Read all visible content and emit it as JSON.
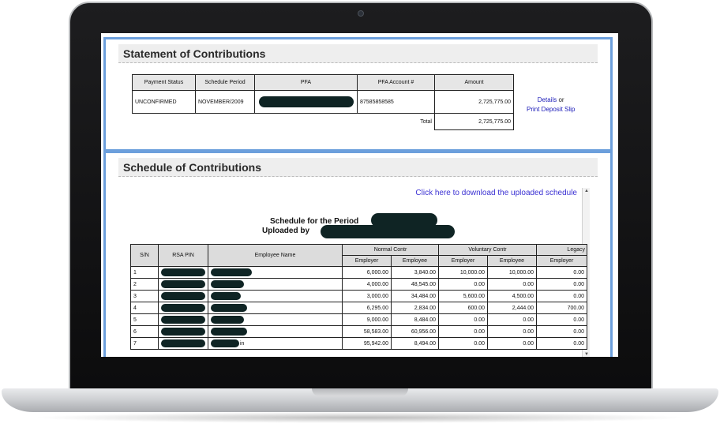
{
  "statement": {
    "title": "Statement of Contributions",
    "headers": [
      "Payment Status",
      "Schedule Period",
      "PFA",
      "PFA Account #",
      "Amount"
    ],
    "row": {
      "payment_status": "UNCONFIRMED",
      "schedule_period": "NOVEMBER/2009",
      "pfa": "",
      "pfa_account": "87585858585",
      "amount": "2,725,775.00"
    },
    "total_label": "Total",
    "total_amount": "2,725,775.00",
    "details_link": "Details",
    "or_text": "or",
    "print_link": "Print Deposit Slip"
  },
  "schedule": {
    "title": "Schedule of Contributions",
    "download_link": "Click here to download the uploaded schedule",
    "period_label": "Schedule for the Period",
    "uploaded_label": "Uploaded by",
    "headers": {
      "sn": "S/N",
      "rsa_pin": "RSA PIN",
      "employee_name": "Employee Name",
      "normal_contr": "Normal Contr",
      "voluntary_contr": "Voluntary Contr",
      "legacy": "Legacy",
      "employer": "Employer",
      "employee": "Employee"
    },
    "rows": [
      {
        "sn": "1",
        "name_tail": "",
        "n_employer": "6,000.00",
        "n_employee": "3,840.00",
        "v_employer": "10,000.00",
        "v_employee": "10,000.00",
        "l_employer": "0.00"
      },
      {
        "sn": "2",
        "name_tail": "",
        "n_employer": "4,000.00",
        "n_employee": "48,545.00",
        "v_employer": "0.00",
        "v_employee": "0.00",
        "l_employer": "0.00"
      },
      {
        "sn": "3",
        "name_tail": "",
        "n_employer": "3,000.00",
        "n_employee": "34,484.00",
        "v_employer": "5,600.00",
        "v_employee": "4,500.00",
        "l_employer": "0.00"
      },
      {
        "sn": "4",
        "name_tail": "",
        "n_employer": "6,295.00",
        "n_employee": "2,834.00",
        "v_employer": "600.00",
        "v_employee": "2,444.00",
        "l_employer": "700.00"
      },
      {
        "sn": "5",
        "name_tail": "",
        "n_employer": "9,000.00",
        "n_employee": "8,484.00",
        "v_employer": "0.00",
        "v_employee": "0.00",
        "l_employer": "0.00"
      },
      {
        "sn": "6",
        "name_tail": "",
        "n_employer": "58,583.00",
        "n_employee": "60,956.00",
        "v_employer": "0.00",
        "v_employee": "0.00",
        "l_employer": "0.00"
      },
      {
        "sn": "7",
        "name_tail": "in",
        "n_employer": "95,942.00",
        "n_employee": "8,494.00",
        "v_employer": "0.00",
        "v_employee": "0.00",
        "l_employer": "0.00"
      }
    ]
  },
  "colors": {
    "panel_border": "#6c9fdc",
    "link": "#1a1ab8",
    "redaction": "#0f2424"
  }
}
